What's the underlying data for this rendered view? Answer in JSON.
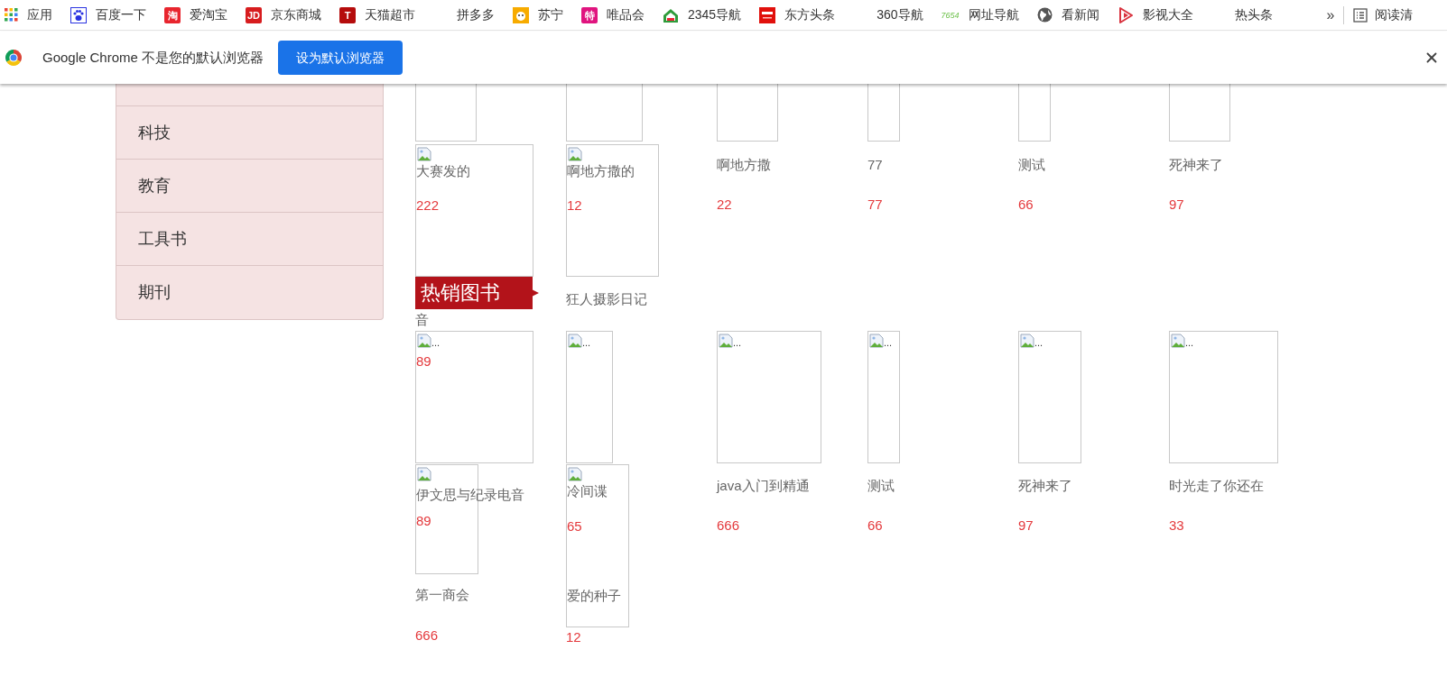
{
  "bookmarks": [
    {
      "label": "应用",
      "kind": "apps"
    },
    {
      "label": "百度一下",
      "kind": "paw"
    },
    {
      "label": "爱淘宝",
      "kind": "badge",
      "badge_text": "淘",
      "color": "#e8252e"
    },
    {
      "label": "京东商城",
      "kind": "badge",
      "badge_text": "JD",
      "color": "#d71c1e"
    },
    {
      "label": "天猫超市",
      "kind": "badge",
      "badge_text": "T",
      "color": "#b50c0c"
    },
    {
      "label": "拼多多",
      "kind": "blank"
    },
    {
      "label": "苏宁",
      "kind": "face"
    },
    {
      "label": "唯品会",
      "kind": "badge",
      "badge_text": "特",
      "color": "#e0147f"
    },
    {
      "label": "2345导航",
      "kind": "house"
    },
    {
      "label": "东方头条",
      "kind": "news"
    },
    {
      "label": "360导航",
      "kind": "blank"
    },
    {
      "label": "网址导航",
      "kind": "tag",
      "badge_text": "7654"
    },
    {
      "label": "看新闻",
      "kind": "globe"
    },
    {
      "label": "影视大全",
      "kind": "play"
    },
    {
      "label": "热头条",
      "kind": "blank"
    }
  ],
  "more": "»",
  "reading_list": "阅读清",
  "infobar": {
    "message": "Google Chrome 不是您的默认浏览器",
    "button": "设为默认浏览器"
  },
  "sidebar": {
    "items": [
      "科技",
      "教育",
      "工具书",
      "期刊"
    ]
  },
  "book_columns": [
    {
      "entries": [
        {
          "kind": "image",
          "broken": false
        },
        {
          "kind": "image",
          "broken": true,
          "contents": [
            {
              "kind": "title",
              "text": "大赛发的"
            },
            {
              "kind": "price",
              "text": "222"
            }
          ]
        },
        {
          "kind": "banner",
          "text": "热销图书"
        },
        {
          "kind": "title",
          "text": "音"
        },
        {
          "kind": "image",
          "broken": true,
          "alt": "...",
          "contents": [
            {
              "kind": "price",
              "text": "89"
            }
          ]
        },
        {
          "kind": "image",
          "broken": true,
          "contents": [
            {
              "kind": "title",
              "text": "伊文思与纪录电音"
            },
            {
              "kind": "price",
              "text": "89"
            }
          ]
        },
        {
          "kind": "title",
          "text": "第一商会"
        },
        {
          "kind": "price",
          "text": "666"
        }
      ]
    },
    {
      "entries": [
        {
          "kind": "image",
          "broken": false
        },
        {
          "kind": "image",
          "broken": true,
          "contents": [
            {
              "kind": "title",
              "text": "啊地方撒的"
            },
            {
              "kind": "price",
              "text": "12"
            }
          ]
        },
        {
          "kind": "title",
          "text": "狂人摄影日记"
        },
        {
          "kind": "image",
          "broken": true,
          "alt": "..."
        },
        {
          "kind": "image",
          "broken": true,
          "contents": [
            {
              "kind": "title",
              "text": "冷间谍"
            },
            {
              "kind": "price",
              "text": "65"
            },
            {
              "kind": "title",
              "text": "爱的种子"
            }
          ]
        },
        {
          "kind": "price",
          "text": "12"
        }
      ]
    },
    {
      "entries": [
        {
          "kind": "image",
          "broken": false
        },
        {
          "kind": "title",
          "text": "啊地方撒"
        },
        {
          "kind": "price",
          "text": "22"
        },
        {
          "kind": "image",
          "broken": true,
          "alt": "..."
        },
        {
          "kind": "title",
          "text": "java入门到精通"
        },
        {
          "kind": "price",
          "text": "666"
        }
      ]
    },
    {
      "entries": [
        {
          "kind": "image",
          "broken": false
        },
        {
          "kind": "title",
          "text": "77"
        },
        {
          "kind": "price",
          "text": "77"
        },
        {
          "kind": "image",
          "broken": true,
          "alt": "..."
        },
        {
          "kind": "title",
          "text": "测试"
        },
        {
          "kind": "price",
          "text": "66"
        }
      ]
    },
    {
      "entries": [
        {
          "kind": "image",
          "broken": false
        },
        {
          "kind": "title",
          "text": "测试"
        },
        {
          "kind": "price",
          "text": "66"
        },
        {
          "kind": "image",
          "broken": true,
          "alt": "..."
        },
        {
          "kind": "title",
          "text": "死神来了"
        },
        {
          "kind": "price",
          "text": "97"
        }
      ]
    },
    {
      "entries": [
        {
          "kind": "image",
          "broken": false
        },
        {
          "kind": "title",
          "text": "死神来了"
        },
        {
          "kind": "price",
          "text": "97"
        },
        {
          "kind": "image",
          "broken": true,
          "alt": "..."
        },
        {
          "kind": "title",
          "text": "时光走了你还在"
        },
        {
          "kind": "price",
          "text": "33"
        }
      ]
    }
  ]
}
